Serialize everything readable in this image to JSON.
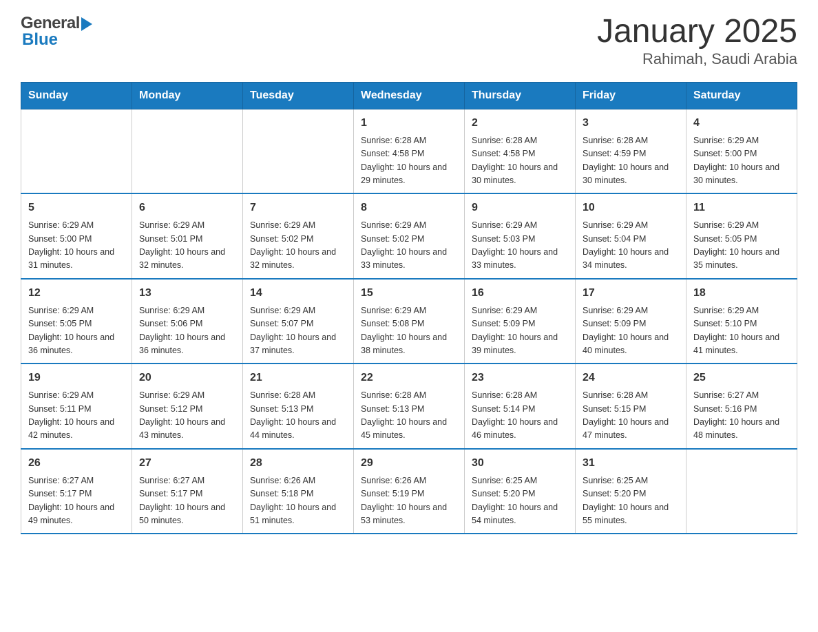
{
  "header": {
    "title": "January 2025",
    "subtitle": "Rahimah, Saudi Arabia",
    "logo_general": "General",
    "logo_blue": "Blue"
  },
  "calendar": {
    "days_of_week": [
      "Sunday",
      "Monday",
      "Tuesday",
      "Wednesday",
      "Thursday",
      "Friday",
      "Saturday"
    ],
    "weeks": [
      [
        {
          "day": "",
          "sunrise": "",
          "sunset": "",
          "daylight": ""
        },
        {
          "day": "",
          "sunrise": "",
          "sunset": "",
          "daylight": ""
        },
        {
          "day": "",
          "sunrise": "",
          "sunset": "",
          "daylight": ""
        },
        {
          "day": "1",
          "sunrise": "Sunrise: 6:28 AM",
          "sunset": "Sunset: 4:58 PM",
          "daylight": "Daylight: 10 hours and 29 minutes."
        },
        {
          "day": "2",
          "sunrise": "Sunrise: 6:28 AM",
          "sunset": "Sunset: 4:58 PM",
          "daylight": "Daylight: 10 hours and 30 minutes."
        },
        {
          "day": "3",
          "sunrise": "Sunrise: 6:28 AM",
          "sunset": "Sunset: 4:59 PM",
          "daylight": "Daylight: 10 hours and 30 minutes."
        },
        {
          "day": "4",
          "sunrise": "Sunrise: 6:29 AM",
          "sunset": "Sunset: 5:00 PM",
          "daylight": "Daylight: 10 hours and 30 minutes."
        }
      ],
      [
        {
          "day": "5",
          "sunrise": "Sunrise: 6:29 AM",
          "sunset": "Sunset: 5:00 PM",
          "daylight": "Daylight: 10 hours and 31 minutes."
        },
        {
          "day": "6",
          "sunrise": "Sunrise: 6:29 AM",
          "sunset": "Sunset: 5:01 PM",
          "daylight": "Daylight: 10 hours and 32 minutes."
        },
        {
          "day": "7",
          "sunrise": "Sunrise: 6:29 AM",
          "sunset": "Sunset: 5:02 PM",
          "daylight": "Daylight: 10 hours and 32 minutes."
        },
        {
          "day": "8",
          "sunrise": "Sunrise: 6:29 AM",
          "sunset": "Sunset: 5:02 PM",
          "daylight": "Daylight: 10 hours and 33 minutes."
        },
        {
          "day": "9",
          "sunrise": "Sunrise: 6:29 AM",
          "sunset": "Sunset: 5:03 PM",
          "daylight": "Daylight: 10 hours and 33 minutes."
        },
        {
          "day": "10",
          "sunrise": "Sunrise: 6:29 AM",
          "sunset": "Sunset: 5:04 PM",
          "daylight": "Daylight: 10 hours and 34 minutes."
        },
        {
          "day": "11",
          "sunrise": "Sunrise: 6:29 AM",
          "sunset": "Sunset: 5:05 PM",
          "daylight": "Daylight: 10 hours and 35 minutes."
        }
      ],
      [
        {
          "day": "12",
          "sunrise": "Sunrise: 6:29 AM",
          "sunset": "Sunset: 5:05 PM",
          "daylight": "Daylight: 10 hours and 36 minutes."
        },
        {
          "day": "13",
          "sunrise": "Sunrise: 6:29 AM",
          "sunset": "Sunset: 5:06 PM",
          "daylight": "Daylight: 10 hours and 36 minutes."
        },
        {
          "day": "14",
          "sunrise": "Sunrise: 6:29 AM",
          "sunset": "Sunset: 5:07 PM",
          "daylight": "Daylight: 10 hours and 37 minutes."
        },
        {
          "day": "15",
          "sunrise": "Sunrise: 6:29 AM",
          "sunset": "Sunset: 5:08 PM",
          "daylight": "Daylight: 10 hours and 38 minutes."
        },
        {
          "day": "16",
          "sunrise": "Sunrise: 6:29 AM",
          "sunset": "Sunset: 5:09 PM",
          "daylight": "Daylight: 10 hours and 39 minutes."
        },
        {
          "day": "17",
          "sunrise": "Sunrise: 6:29 AM",
          "sunset": "Sunset: 5:09 PM",
          "daylight": "Daylight: 10 hours and 40 minutes."
        },
        {
          "day": "18",
          "sunrise": "Sunrise: 6:29 AM",
          "sunset": "Sunset: 5:10 PM",
          "daylight": "Daylight: 10 hours and 41 minutes."
        }
      ],
      [
        {
          "day": "19",
          "sunrise": "Sunrise: 6:29 AM",
          "sunset": "Sunset: 5:11 PM",
          "daylight": "Daylight: 10 hours and 42 minutes."
        },
        {
          "day": "20",
          "sunrise": "Sunrise: 6:29 AM",
          "sunset": "Sunset: 5:12 PM",
          "daylight": "Daylight: 10 hours and 43 minutes."
        },
        {
          "day": "21",
          "sunrise": "Sunrise: 6:28 AM",
          "sunset": "Sunset: 5:13 PM",
          "daylight": "Daylight: 10 hours and 44 minutes."
        },
        {
          "day": "22",
          "sunrise": "Sunrise: 6:28 AM",
          "sunset": "Sunset: 5:13 PM",
          "daylight": "Daylight: 10 hours and 45 minutes."
        },
        {
          "day": "23",
          "sunrise": "Sunrise: 6:28 AM",
          "sunset": "Sunset: 5:14 PM",
          "daylight": "Daylight: 10 hours and 46 minutes."
        },
        {
          "day": "24",
          "sunrise": "Sunrise: 6:28 AM",
          "sunset": "Sunset: 5:15 PM",
          "daylight": "Daylight: 10 hours and 47 minutes."
        },
        {
          "day": "25",
          "sunrise": "Sunrise: 6:27 AM",
          "sunset": "Sunset: 5:16 PM",
          "daylight": "Daylight: 10 hours and 48 minutes."
        }
      ],
      [
        {
          "day": "26",
          "sunrise": "Sunrise: 6:27 AM",
          "sunset": "Sunset: 5:17 PM",
          "daylight": "Daylight: 10 hours and 49 minutes."
        },
        {
          "day": "27",
          "sunrise": "Sunrise: 6:27 AM",
          "sunset": "Sunset: 5:17 PM",
          "daylight": "Daylight: 10 hours and 50 minutes."
        },
        {
          "day": "28",
          "sunrise": "Sunrise: 6:26 AM",
          "sunset": "Sunset: 5:18 PM",
          "daylight": "Daylight: 10 hours and 51 minutes."
        },
        {
          "day": "29",
          "sunrise": "Sunrise: 6:26 AM",
          "sunset": "Sunset: 5:19 PM",
          "daylight": "Daylight: 10 hours and 53 minutes."
        },
        {
          "day": "30",
          "sunrise": "Sunrise: 6:25 AM",
          "sunset": "Sunset: 5:20 PM",
          "daylight": "Daylight: 10 hours and 54 minutes."
        },
        {
          "day": "31",
          "sunrise": "Sunrise: 6:25 AM",
          "sunset": "Sunset: 5:20 PM",
          "daylight": "Daylight: 10 hours and 55 minutes."
        },
        {
          "day": "",
          "sunrise": "",
          "sunset": "",
          "daylight": ""
        }
      ]
    ]
  }
}
